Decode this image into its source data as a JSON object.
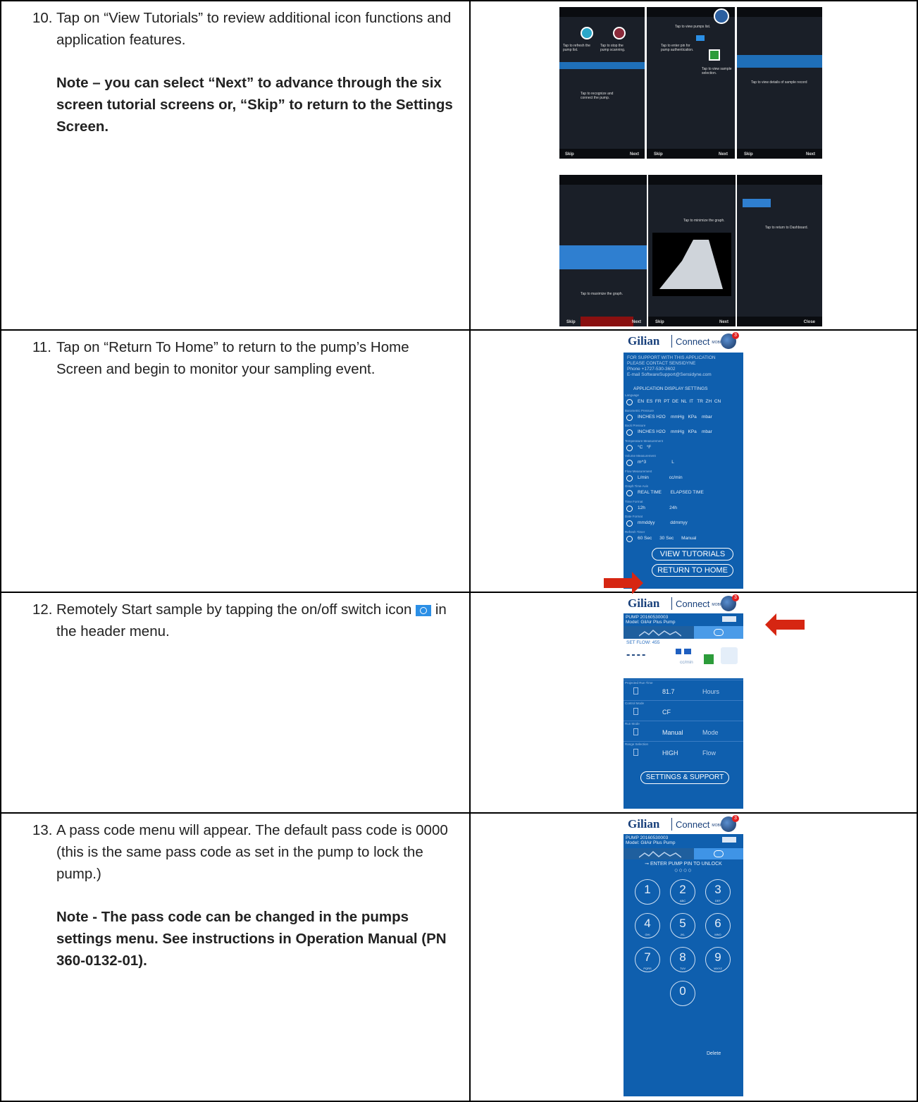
{
  "steps": [
    {
      "num": "10.",
      "text": "Tap on “View Tutorials” to review additional icon functions and application features.",
      "note": "Note – you can select “Next” to advance through the six screen tutorial screens or, “Skip” to return to the Settings Screen."
    },
    {
      "num": "11.",
      "text": "Tap on “Return To Home” to return to the pump’s Home Screen and begin to monitor your sampling event."
    },
    {
      "num": "12.",
      "text_a": "Remotely Start sample by tapping the on/off switch icon",
      "text_b": "in the header menu."
    },
    {
      "num": "13.",
      "text": "A pass code menu will appear. The default pass code is 0000 (this is the same pass code as set in the pump to lock the pump.)",
      "note": "Note - The pass code can be changed in the pumps settings menu. See instructions in Operation Manual (PN 360-0132-01)."
    }
  ],
  "tutorial": {
    "skip": "Skip",
    "next": "Next",
    "close": "Close",
    "hints": [
      "Tap to refresh the pump list.",
      "Tap to stop the pump scanning.",
      "Tap to recognize and connect the pump.",
      "Tap to view pumps list.",
      "Tap to enter pin for pump authentication.",
      "Tap to view sample selection.",
      "Tap to view details of sample record",
      "Tap to maximize the graph.",
      "Tap to minimize the graph.",
      "Tap to return to Dashboard."
    ]
  },
  "app": {
    "brand": "Gilian",
    "connect": "Connect",
    "mobile": "MOBILE",
    "badge": "3",
    "pump_id": "PUMP 20160530003",
    "model": "Model: GilAir Plus Pump"
  },
  "settings": {
    "support_line1": "FOR SUPPORT WITH THIS APPLICATION",
    "support_line2": "PLEASE CONTACT SENSIDYNE",
    "phone": "Phone     +1727-530-3602",
    "email": "E-mail    SoftwareSupport@Sensidyne.com",
    "section": "APPLICATION DISPLAY SETTINGS",
    "rows": [
      {
        "label": "Language",
        "value": "EN  ES  FR  PT  DE  NL  IT   TR  ZH  CN"
      },
      {
        "label": "Barometric Pressure",
        "value": "INCHES H2O    mmHg   KPa    mbar"
      },
      {
        "label": "Back Pressure",
        "value": "INCHES H2O    mmHg   KPa    mbar"
      },
      {
        "label": "Temperature Measurement",
        "value": "°C   °F"
      },
      {
        "label": "Volume Measurement",
        "value": "m^3                    L"
      },
      {
        "label": "Flow Measurement",
        "value": "L/min                cc/min"
      },
      {
        "label": "Graph Time Axis",
        "value": "REAL TIME       ELAPSED TIME"
      },
      {
        "label": "Time Format",
        "value": "12h                   24h"
      },
      {
        "label": "Date Format",
        "value": "mmddyy            ddmmyy"
      },
      {
        "label": "Refresh Timer",
        "value": "60 Sec      30 Sec      Manual"
      }
    ],
    "view_tutorials": "VIEW TUTORIALS",
    "return_home": "RETURN TO HOME"
  },
  "home": {
    "set_flow": "SET FLOW: 455",
    "dashes": "----",
    "unit": "cc/min",
    "rows": [
      {
        "label": "Projected Run Time",
        "value": "81.7",
        "unit": "Hours"
      },
      {
        "label": "Control Mode",
        "value": "CF",
        "unit": ""
      },
      {
        "label": "Run Mode",
        "value": "Manual",
        "unit": "Mode"
      },
      {
        "label": "Range Selection",
        "value": "HIGH",
        "unit": "Flow"
      }
    ],
    "settings_button": "SETTINGS & SUPPORT"
  },
  "pin": {
    "prompt": "ENTER PUMP PIN TO UNLOCK",
    "keys": [
      {
        "d": "1",
        "l": ""
      },
      {
        "d": "2",
        "l": "ABC"
      },
      {
        "d": "3",
        "l": "DEF"
      },
      {
        "d": "4",
        "l": "GHI"
      },
      {
        "d": "5",
        "l": "JKL"
      },
      {
        "d": "6",
        "l": "MNO"
      },
      {
        "d": "7",
        "l": "PQRS"
      },
      {
        "d": "8",
        "l": "TUV"
      },
      {
        "d": "9",
        "l": "WXYZ"
      },
      {
        "d": "0",
        "l": ""
      }
    ],
    "delete": "Delete"
  }
}
